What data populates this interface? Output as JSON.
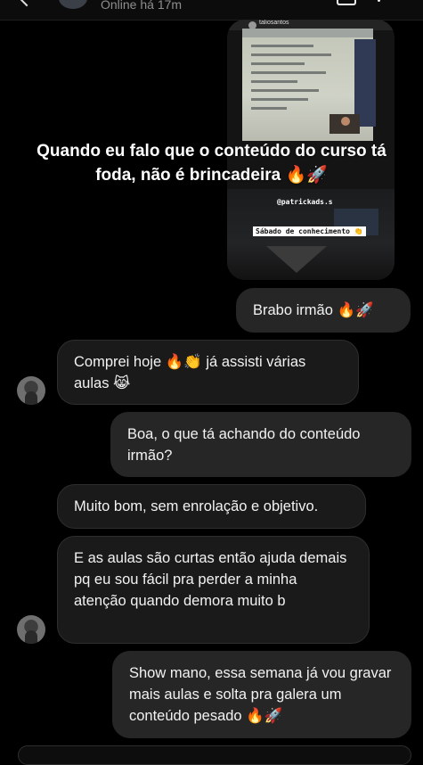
{
  "header": {
    "status": "Online há 17m",
    "back_icon": "chevron-left-icon",
    "call_icon": "video-call-icon",
    "info_icon": "info-icon"
  },
  "story": {
    "username": "taliosantos",
    "caption": "Quando eu falo que o conteúdo do curso tá foda, não é brincadeira 🔥🚀",
    "handle": "@patrickads.s",
    "sticker": "Sábado de conhecimento 👏"
  },
  "messages": [
    {
      "from": "me",
      "text": "Brabo irmão 🔥🚀"
    },
    {
      "from": "them",
      "text": "Comprei hoje 🔥👏 já assisti várias aulas 😹"
    },
    {
      "from": "me",
      "text": "Boa, o que tá achando do conteúdo irmão?"
    },
    {
      "from": "them",
      "text": "Muito bom, sem enrolação e objetivo."
    },
    {
      "from": "them",
      "text": "E as aulas são curtas então ajuda demais pq eu sou fácil pra perder a minha atenção quando demora muito b"
    },
    {
      "from": "me",
      "text": "Show mano, essa semana já vou gravar mais aulas e solta pra galera um conteúdo pesado 🔥🚀"
    }
  ],
  "colors": {
    "background": "#000000",
    "incoming_bubble": "#1a1a1a",
    "outgoing_bubble": "#262626",
    "text": "#f2f2f2"
  }
}
